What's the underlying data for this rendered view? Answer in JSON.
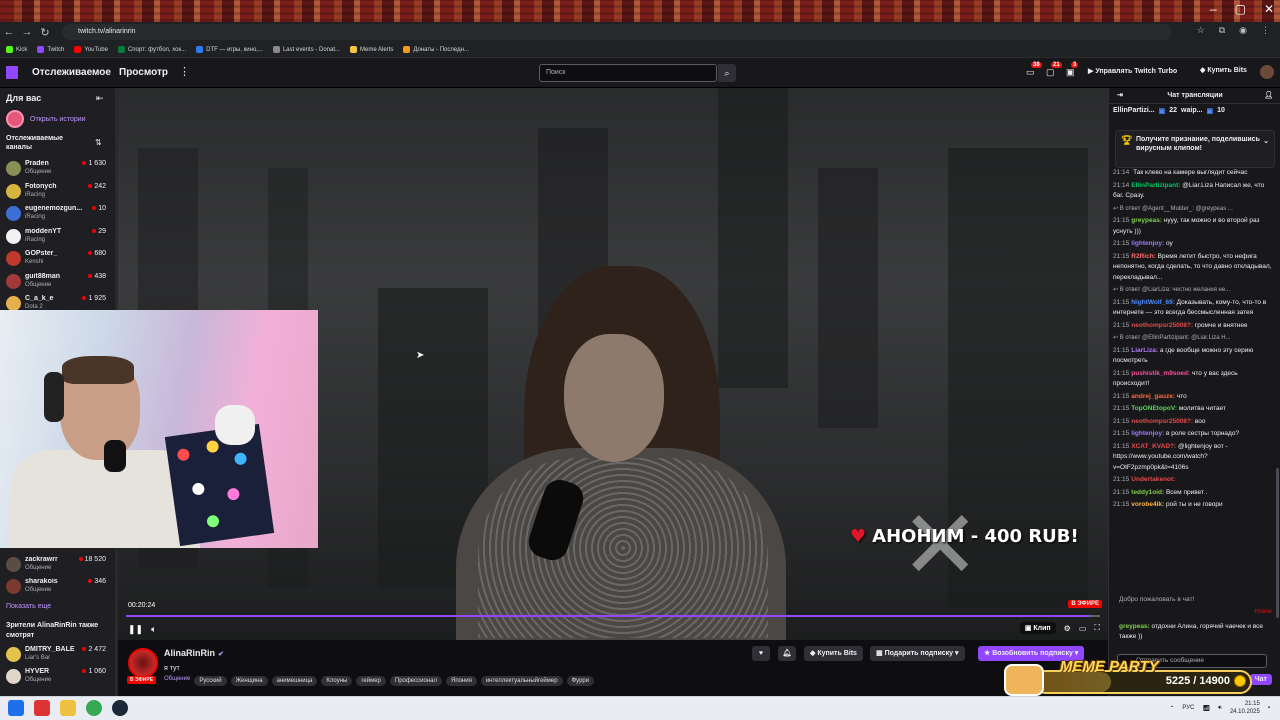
{
  "browser": {
    "url": "twitch.tv/alinarinrin",
    "bookmarks": [
      "Kick",
      "Twitch",
      "YouTube",
      "Спорт: футбол, хок...",
      "DTF — игры, кино,...",
      "Last events - Donat...",
      "Meme Alerts",
      "Донаты - Последн..."
    ]
  },
  "nav": {
    "following": "Отслеживаемое",
    "browse": "Просмотр",
    "more": "⋮",
    "search_placeholder": "Поиск",
    "notif1": "38",
    "notif2": "21",
    "notif3": "3",
    "turbo": "Управлять Twitch Turbo",
    "buy_bits": "Купить Bits"
  },
  "sidebar": {
    "title": "Для вас",
    "stories": "Открыть истории",
    "followed_title": "Отслеживаемые каналы",
    "channels": [
      {
        "name": "Praden",
        "game": "Общение",
        "viewers": "1 630",
        "color": "#8a8f55"
      },
      {
        "name": "Fotonych",
        "game": "iRacing",
        "viewers": "242",
        "color": "#d6b43e"
      },
      {
        "name": "eugenemozgun...",
        "game": "iRacing",
        "viewers": "10",
        "color": "#3b6fd6"
      },
      {
        "name": "moddenYT",
        "game": "iRacing",
        "viewers": "29",
        "color": "#f2f2f2"
      },
      {
        "name": "GOPster_",
        "game": "Kenshi",
        "viewers": "680",
        "color": "#c0392b"
      },
      {
        "name": "guit88man",
        "game": "Общение",
        "viewers": "438",
        "color": "#a33a3a"
      },
      {
        "name": "C_a_k_e",
        "game": "Dota 2",
        "viewers": "1 925",
        "color": "#e3b04b"
      }
    ],
    "channels_bottom": [
      {
        "name": "zackrawrr",
        "game": "Общение",
        "viewers": "18 520",
        "color": "#5a4e44"
      },
      {
        "name": "sharakois",
        "game": "Общение",
        "viewers": "346",
        "color": "#7a3b2e"
      }
    ],
    "show_more": "Показать еще",
    "also_watch": "Зрители AlinaRinRin также смотрят",
    "also_channels": [
      {
        "name": "DMITRY_BALE",
        "game": "Liar's Bar",
        "viewers": "2 472",
        "color": "#e3c34b"
      },
      {
        "name": "HYVER",
        "game": "Общение",
        "viewers": "1 060",
        "color": "#e0d6c8"
      }
    ]
  },
  "video": {
    "donation": "АНОНИМ - 400 RUB!",
    "time": "00:20:24",
    "live": "В ЭФИРЕ",
    "progress": 0.99,
    "clip": "Клип"
  },
  "channel": {
    "name": "AlinaRinRin",
    "title": "я тут",
    "live": "В ЭФИРЕ",
    "category": "Общение",
    "tags": [
      "Русский",
      "Женщина",
      "анимешница",
      "Клоуны",
      "геймер",
      "Профессионал",
      "Япония",
      "интеллектуальныйгеймер",
      "Фурри"
    ],
    "buy_bits": "Купить Bits",
    "gift_sub": "Подарить подписку",
    "resub": "Возобновить подписку"
  },
  "chat": {
    "header": "Чат трансляции",
    "gift1_user": "EllinPartizi...",
    "gift1_count": "22",
    "gift2_user": "waip...",
    "gift2_count": "10",
    "pinned": "Получите признание, поделившись вирусным клипом!",
    "messages": [
      {
        "time": "21:14",
        "user": "",
        "color": "#ff4f4f",
        "text": "Так клево на камере выглядит сейчас"
      },
      {
        "time": "21:14",
        "user": "EllinPartizipant:",
        "color": "#00c864",
        "text": "@Liar.Liza Написал же, что баг. Сразу."
      },
      {
        "reply": "В ответ @Agent__Mulder_: @greypeas ..."
      },
      {
        "time": "21:15",
        "user": "greypeas:",
        "color": "#7fd14a",
        "text": "нууу, так можно и во второй раз уснуть )))"
      },
      {
        "time": "21:15",
        "user": "lightenjoy:",
        "color": "#9f7aff",
        "text": "оу"
      },
      {
        "time": "21:15",
        "user": "R2Rich:",
        "color": "#ff6b6b",
        "text": "Время летит быстро, что нефига непонятно, когда сделать, то что давно откладывал, перекладывал..."
      },
      {
        "reply": "В ответ @LiarLiza: честно желания не..."
      },
      {
        "time": "21:15",
        "user": "NightWolf_69:",
        "color": "#4f8bff",
        "text": "Доказывать, кому-то, что-то в интернете — это всегда бессмысленная затея"
      },
      {
        "time": "21:15",
        "user": "neothompsr25008?:",
        "color": "#e34b4b",
        "text": "громче и внятнее"
      },
      {
        "reply": "В ответ @EllinPartizipant: @Liar.Liza H..."
      },
      {
        "time": "21:15",
        "user": "LiarLiza:",
        "color": "#b07bff",
        "text": "а где вообще можно эту серию посмотреть"
      },
      {
        "time": "21:15",
        "user": "pushistik_m9soed:",
        "color": "#ff4fa0",
        "text": "что у вас здесь происходит!"
      },
      {
        "time": "21:15",
        "user": "andrej_gauze:",
        "color": "#ff6a3d",
        "text": "что"
      },
      {
        "time": "21:15",
        "user": "TopONEtopoV:",
        "color": "#5bd35b",
        "text": "молитва читает"
      },
      {
        "time": "21:15",
        "user": "neothompsr25008?:",
        "color": "#e34b4b",
        "text": "воо"
      },
      {
        "time": "21:15",
        "user": "lightenjoy:",
        "color": "#9f7aff",
        "text": "в роле сестры торнадо?"
      },
      {
        "time": "21:15",
        "user": "XCAT_KVAD?:",
        "color": "#e34b4b",
        "text": "@lightenjoy вот - https://www.youtube.com/watch?v=OtF2pzmp0pk&t=4106s"
      },
      {
        "time": "21:15",
        "user": "Undertakenot:",
        "color": "#e34b4b",
        "text": ""
      },
      {
        "time": "21:15",
        "user": "teddy1oid:",
        "color": "#7fd14a",
        "text": "Всем привет ."
      },
      {
        "time": "21:15",
        "user": "vorobe4ik:",
        "color": "#ffb347",
        "text": "рой ты и не говори"
      }
    ],
    "welcome": "Добро пожаловать в чат!",
    "new_label": "Новое",
    "last_user": "greypeas:",
    "last_text": "отдохни Алина, горячий чаечек и все также ))",
    "input_placeholder": "Отправить сообщение",
    "send": "Чат"
  },
  "meme_party": {
    "title": "MEME PARTY",
    "count": "5225 / 14900",
    "progress": 0.35
  },
  "taskbar": {
    "lang": "РУС",
    "time": "21:15",
    "date": "24.10.2025"
  }
}
